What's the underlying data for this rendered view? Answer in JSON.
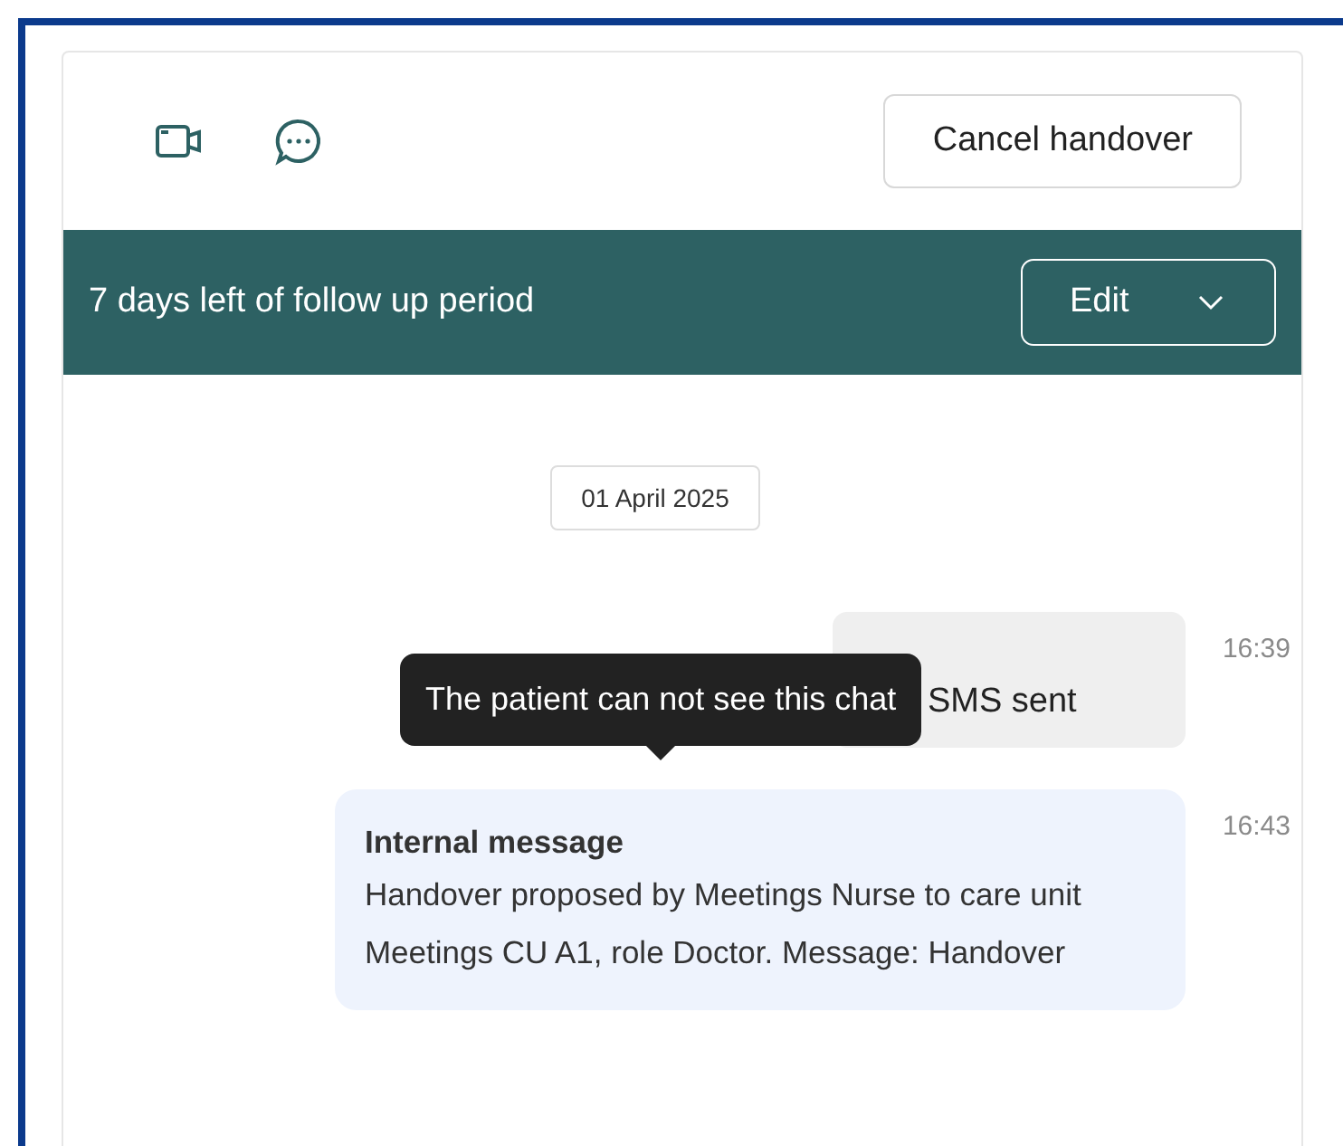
{
  "header": {
    "cancel_button": "Cancel handover"
  },
  "banner": {
    "text": "7 days left of follow up period",
    "edit_button": "Edit"
  },
  "date_separator": "01 April 2025",
  "messages": [
    {
      "kind": "status",
      "text": "SMS sent",
      "time": "16:39"
    },
    {
      "kind": "internal",
      "title": "Internal message",
      "text": "Handover proposed by Meetings Nurse to care unit Meetings CU A1, role Doctor. Message: Handover",
      "time": "16:43"
    }
  ],
  "tooltip": "The patient can not see this chat"
}
